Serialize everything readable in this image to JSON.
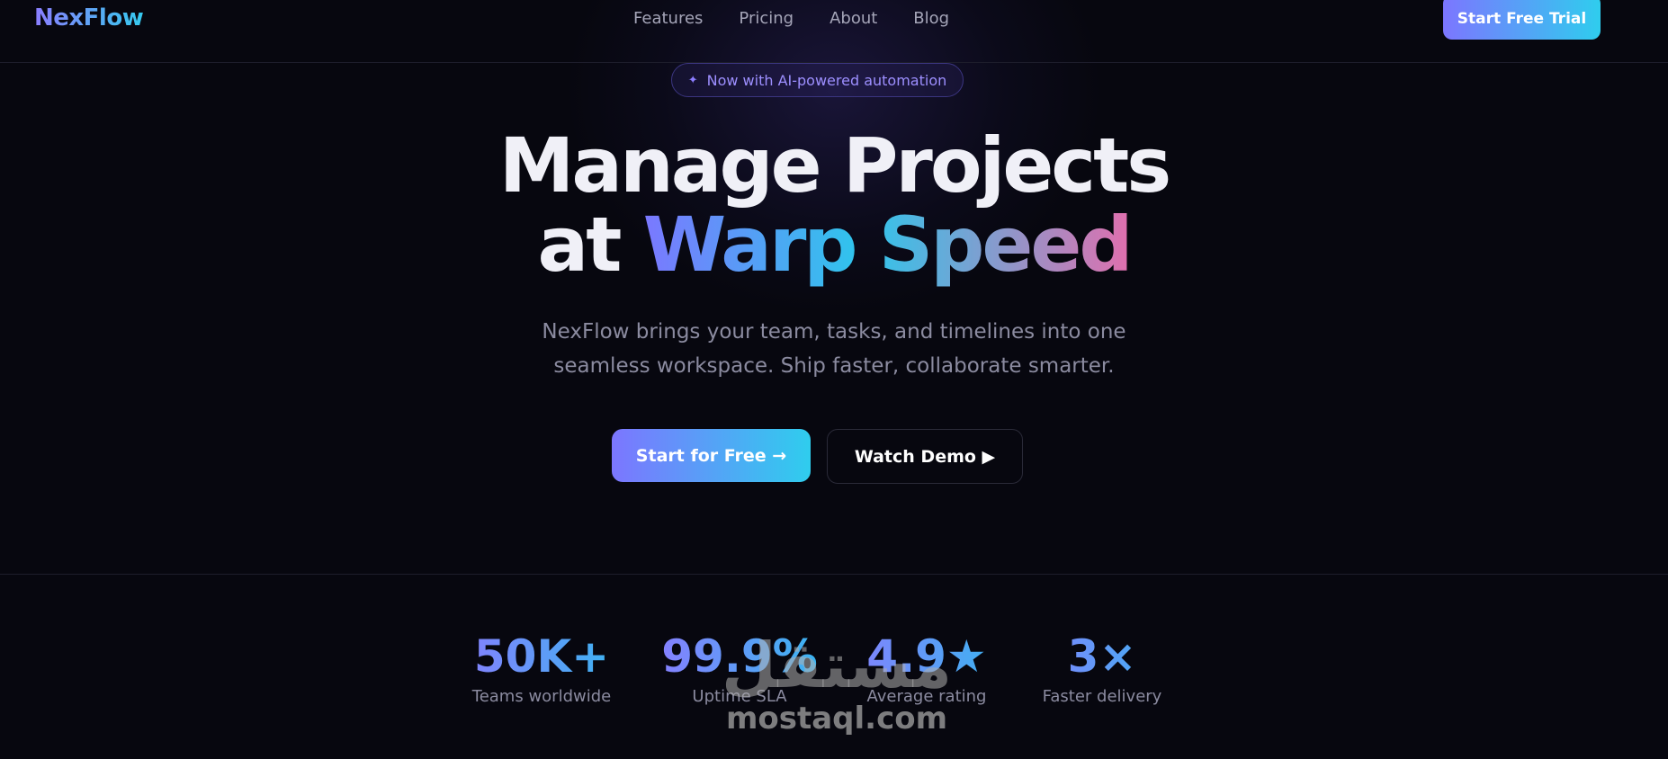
{
  "header": {
    "logo": "NexFlow",
    "nav": [
      "Features",
      "Pricing",
      "About",
      "Blog"
    ],
    "cta_label": "Start Free Trial"
  },
  "badge": {
    "icon": "sparkle-icon",
    "text": "Now with AI-powered automation"
  },
  "hero": {
    "title_line1": "Manage Projects",
    "title_line2_prefix": "at",
    "title_line2_highlight": "Warp Speed",
    "subtitle_line1": "NexFlow brings your team, tasks, and timelines into one",
    "subtitle_line2": "seamless workspace. Ship faster, collaborate smarter.",
    "primary_cta": "Start for Free →",
    "secondary_cta": "Watch Demo ▶"
  },
  "stats": [
    {
      "value": "50K+",
      "label": "Teams worldwide"
    },
    {
      "value": "99.9%",
      "label": "Uptime SLA"
    },
    {
      "value": "4.9★",
      "label": "Average rating"
    },
    {
      "value": "3×",
      "label": "Faster delivery"
    }
  ],
  "watermark": {
    "arabic": "مستقل",
    "latin": "mostaql.com"
  },
  "colors": {
    "background": "#07070f",
    "gradient_start": "#7c76ff",
    "gradient_end": "#2fcdee",
    "accent_pink": "#e06fae",
    "muted_text": "#8b8ba0"
  }
}
